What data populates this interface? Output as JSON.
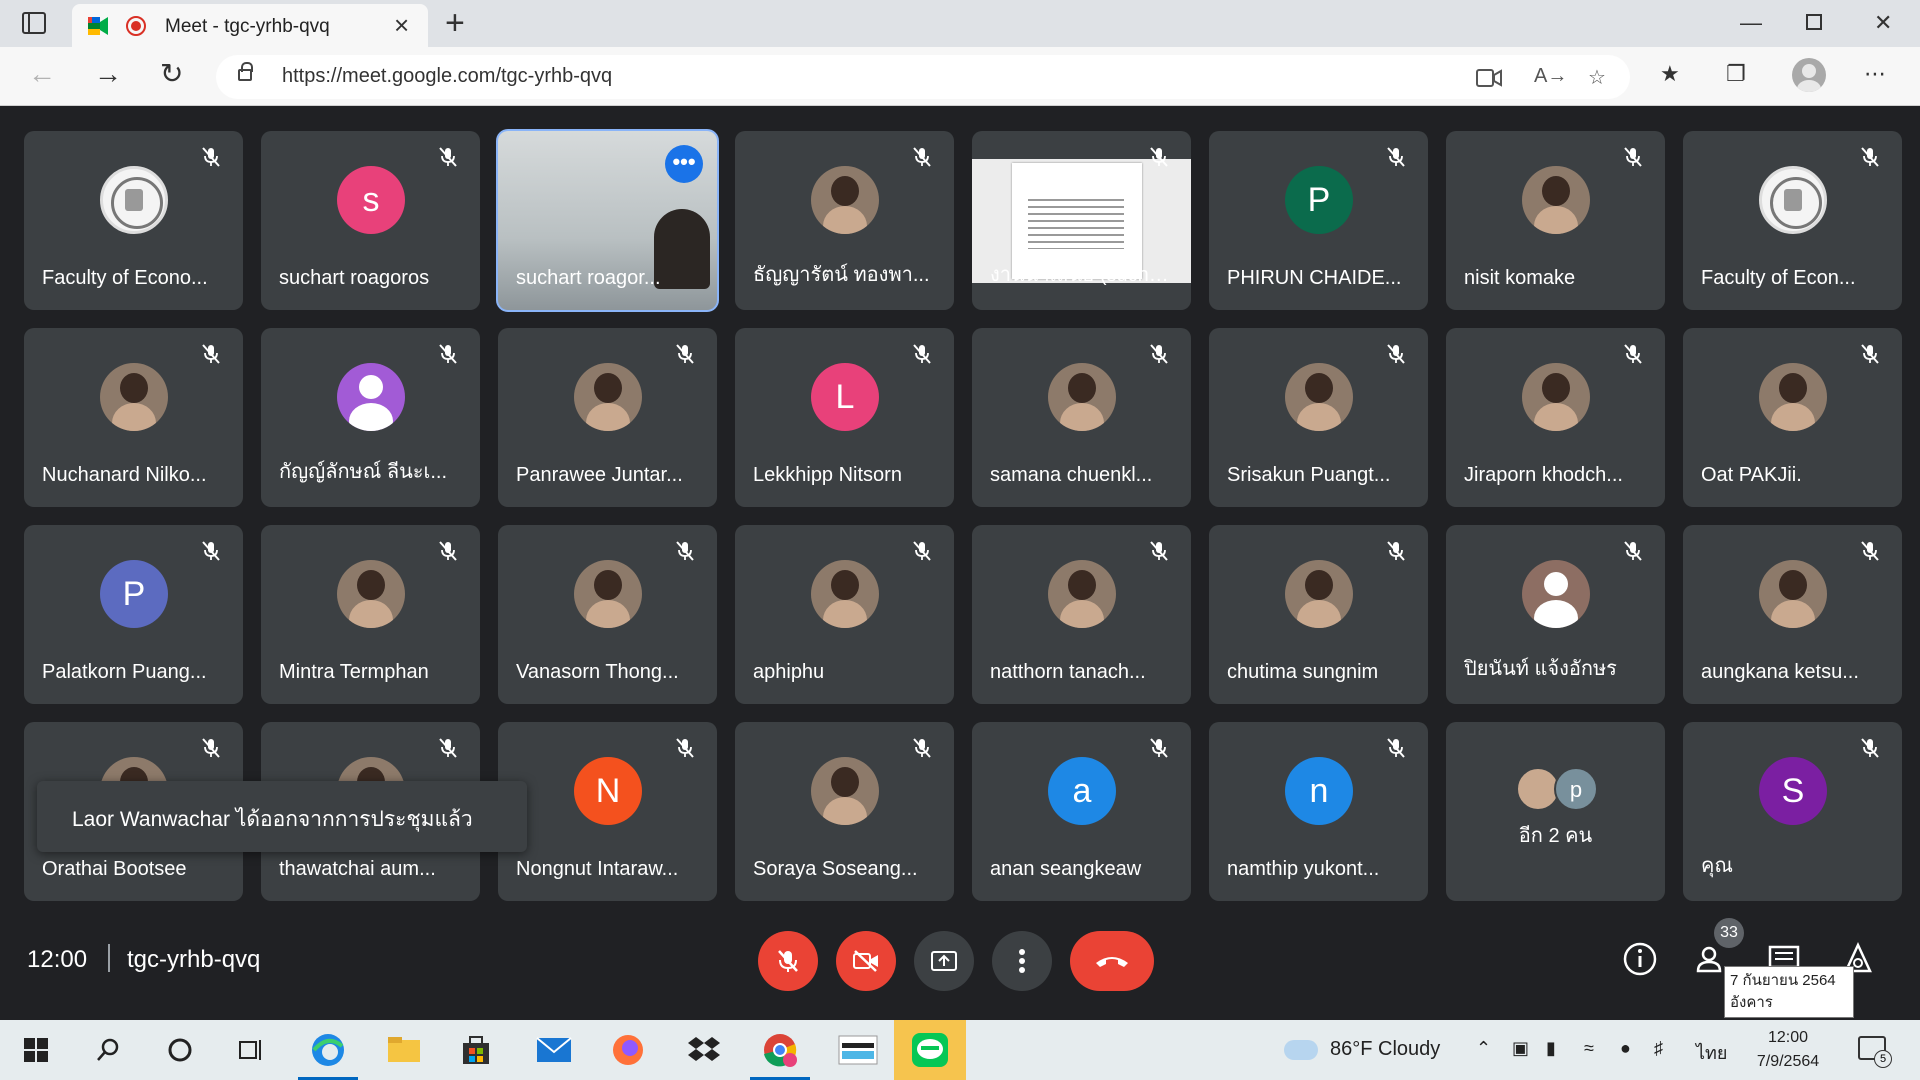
{
  "browser": {
    "tab_title": "Meet - tgc-yrhb-qvq",
    "new_tab_glyph": "+",
    "close_glyph": "×",
    "url": "https://meet.google.com/tgc-yrhb-qvq"
  },
  "grid": {
    "tiles": [
      {
        "name": "Faculty of Econo...",
        "avatar_type": "seal"
      },
      {
        "name": "suchart roagoros",
        "avatar_type": "letter",
        "letter": "s",
        "color": "#e8417a"
      },
      {
        "name": "suchart roagor...",
        "avatar_type": "video"
      },
      {
        "name": "ธัญญารัตน์ ทองพา...",
        "avatar_type": "photo"
      },
      {
        "name": "งานนำเสนอ (suchart roago...",
        "avatar_type": "document"
      },
      {
        "name": "PHIRUN CHAIDE...",
        "avatar_type": "letter",
        "letter": "P",
        "color": "#0b6b4c"
      },
      {
        "name": "nisit komake",
        "avatar_type": "photo"
      },
      {
        "name": "Faculty of Econ...",
        "avatar_type": "seal"
      },
      {
        "name": "Nuchanard Nilko...",
        "avatar_type": "photo"
      },
      {
        "name": "กัญญ์ลักษณ์ ลีนะเ...",
        "avatar_type": "user",
        "color": "#a25bd6"
      },
      {
        "name": "Panrawee Juntar...",
        "avatar_type": "photo"
      },
      {
        "name": "Lekkhipp Nitsorn",
        "avatar_type": "letter",
        "letter": "L",
        "color": "#e8417a"
      },
      {
        "name": "samana chuenkl...",
        "avatar_type": "photo"
      },
      {
        "name": "Srisakun Puangt...",
        "avatar_type": "photo"
      },
      {
        "name": "Jiraporn khodch...",
        "avatar_type": "photo"
      },
      {
        "name": "Oat PAKJii.",
        "avatar_type": "photo"
      },
      {
        "name": "Palatkorn Puang...",
        "avatar_type": "letter",
        "letter": "P",
        "color": "#5c6bc0"
      },
      {
        "name": "Mintra Termphan",
        "avatar_type": "photo"
      },
      {
        "name": "Vanasorn Thong...",
        "avatar_type": "photo"
      },
      {
        "name": "aphiphu",
        "avatar_type": "photo"
      },
      {
        "name": "natthorn tanach...",
        "avatar_type": "photo"
      },
      {
        "name": "chutima sungnim",
        "avatar_type": "photo"
      },
      {
        "name": "ปิยนันท์ แจ้งอักษร",
        "avatar_type": "user",
        "color": "#8d6e63"
      },
      {
        "name": "aungkana ketsu...",
        "avatar_type": "photo"
      },
      {
        "name": "Orathai Bootsee",
        "avatar_type": "photo"
      },
      {
        "name": "thawatchai aum...",
        "avatar_type": "photo"
      },
      {
        "name": "Nongnut Intaraw...",
        "avatar_type": "letter",
        "letter": "N",
        "color": "#f4511e"
      },
      {
        "name": "Soraya Soseang...",
        "avatar_type": "photo"
      },
      {
        "name": "anan seangkeaw",
        "avatar_type": "letter",
        "letter": "a",
        "color": "#1e88e5"
      },
      {
        "name": "namthip yukont...",
        "avatar_type": "letter",
        "letter": "n",
        "color": "#1e88e5"
      },
      {
        "name": "อีก 2 คน",
        "avatar_type": "others",
        "letter": "p"
      },
      {
        "name": "คุณ",
        "avatar_type": "letter",
        "letter": "S",
        "color": "#7b1fa2"
      }
    ]
  },
  "toast": {
    "text": "Laor Wanwachar ได้ออกจากการประชุมแล้ว"
  },
  "meetbar": {
    "time": "12:00",
    "meeting_code": "tgc-yrhb-qvq",
    "participants_count": "33"
  },
  "tooltip": {
    "date_line": "7 กันยายน 2564",
    "day_line": "อังคาร"
  },
  "taskbar": {
    "weather": "86°F  Cloudy",
    "language": "ไทย",
    "clock_time": "12:00",
    "clock_date": "7/9/2564",
    "notification_count": "5"
  },
  "colors": {
    "meet_bg": "#202124",
    "tile_bg": "#3c4043",
    "end_call": "#ea4335",
    "active_outline": "#8ab4f8"
  }
}
